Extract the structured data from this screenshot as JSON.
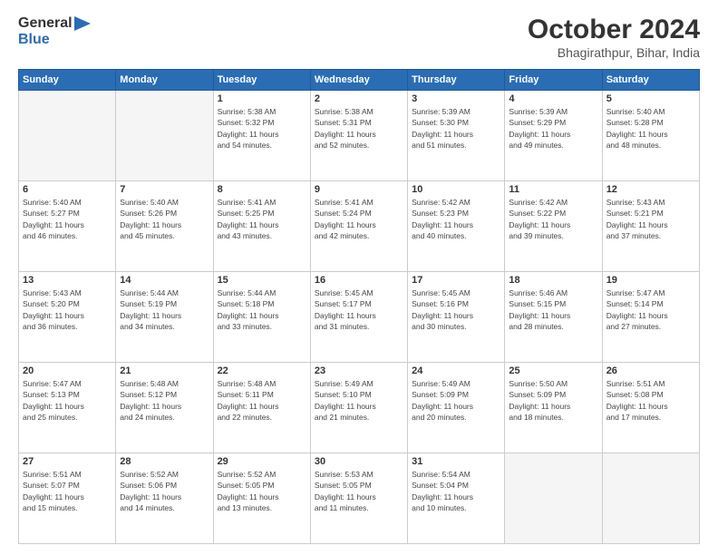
{
  "header": {
    "logo_line1": "General",
    "logo_line2": "Blue",
    "month_title": "October 2024",
    "location": "Bhagirathpur, Bihar, India"
  },
  "calendar": {
    "headers": [
      "Sunday",
      "Monday",
      "Tuesday",
      "Wednesday",
      "Thursday",
      "Friday",
      "Saturday"
    ],
    "weeks": [
      [
        {
          "day": "",
          "empty": true
        },
        {
          "day": "",
          "empty": true
        },
        {
          "day": "1",
          "sunrise": "5:38 AM",
          "sunset": "5:32 PM",
          "daylight": "11 hours and 54 minutes."
        },
        {
          "day": "2",
          "sunrise": "5:38 AM",
          "sunset": "5:31 PM",
          "daylight": "11 hours and 52 minutes."
        },
        {
          "day": "3",
          "sunrise": "5:39 AM",
          "sunset": "5:30 PM",
          "daylight": "11 hours and 51 minutes."
        },
        {
          "day": "4",
          "sunrise": "5:39 AM",
          "sunset": "5:29 PM",
          "daylight": "11 hours and 49 minutes."
        },
        {
          "day": "5",
          "sunrise": "5:40 AM",
          "sunset": "5:28 PM",
          "daylight": "11 hours and 48 minutes."
        }
      ],
      [
        {
          "day": "6",
          "sunrise": "5:40 AM",
          "sunset": "5:27 PM",
          "daylight": "11 hours and 46 minutes."
        },
        {
          "day": "7",
          "sunrise": "5:40 AM",
          "sunset": "5:26 PM",
          "daylight": "11 hours and 45 minutes."
        },
        {
          "day": "8",
          "sunrise": "5:41 AM",
          "sunset": "5:25 PM",
          "daylight": "11 hours and 43 minutes."
        },
        {
          "day": "9",
          "sunrise": "5:41 AM",
          "sunset": "5:24 PM",
          "daylight": "11 hours and 42 minutes."
        },
        {
          "day": "10",
          "sunrise": "5:42 AM",
          "sunset": "5:23 PM",
          "daylight": "11 hours and 40 minutes."
        },
        {
          "day": "11",
          "sunrise": "5:42 AM",
          "sunset": "5:22 PM",
          "daylight": "11 hours and 39 minutes."
        },
        {
          "day": "12",
          "sunrise": "5:43 AM",
          "sunset": "5:21 PM",
          "daylight": "11 hours and 37 minutes."
        }
      ],
      [
        {
          "day": "13",
          "sunrise": "5:43 AM",
          "sunset": "5:20 PM",
          "daylight": "11 hours and 36 minutes."
        },
        {
          "day": "14",
          "sunrise": "5:44 AM",
          "sunset": "5:19 PM",
          "daylight": "11 hours and 34 minutes."
        },
        {
          "day": "15",
          "sunrise": "5:44 AM",
          "sunset": "5:18 PM",
          "daylight": "11 hours and 33 minutes."
        },
        {
          "day": "16",
          "sunrise": "5:45 AM",
          "sunset": "5:17 PM",
          "daylight": "11 hours and 31 minutes."
        },
        {
          "day": "17",
          "sunrise": "5:45 AM",
          "sunset": "5:16 PM",
          "daylight": "11 hours and 30 minutes."
        },
        {
          "day": "18",
          "sunrise": "5:46 AM",
          "sunset": "5:15 PM",
          "daylight": "11 hours and 28 minutes."
        },
        {
          "day": "19",
          "sunrise": "5:47 AM",
          "sunset": "5:14 PM",
          "daylight": "11 hours and 27 minutes."
        }
      ],
      [
        {
          "day": "20",
          "sunrise": "5:47 AM",
          "sunset": "5:13 PM",
          "daylight": "11 hours and 25 minutes."
        },
        {
          "day": "21",
          "sunrise": "5:48 AM",
          "sunset": "5:12 PM",
          "daylight": "11 hours and 24 minutes."
        },
        {
          "day": "22",
          "sunrise": "5:48 AM",
          "sunset": "5:11 PM",
          "daylight": "11 hours and 22 minutes."
        },
        {
          "day": "23",
          "sunrise": "5:49 AM",
          "sunset": "5:10 PM",
          "daylight": "11 hours and 21 minutes."
        },
        {
          "day": "24",
          "sunrise": "5:49 AM",
          "sunset": "5:09 PM",
          "daylight": "11 hours and 20 minutes."
        },
        {
          "day": "25",
          "sunrise": "5:50 AM",
          "sunset": "5:09 PM",
          "daylight": "11 hours and 18 minutes."
        },
        {
          "day": "26",
          "sunrise": "5:51 AM",
          "sunset": "5:08 PM",
          "daylight": "11 hours and 17 minutes."
        }
      ],
      [
        {
          "day": "27",
          "sunrise": "5:51 AM",
          "sunset": "5:07 PM",
          "daylight": "11 hours and 15 minutes."
        },
        {
          "day": "28",
          "sunrise": "5:52 AM",
          "sunset": "5:06 PM",
          "daylight": "11 hours and 14 minutes."
        },
        {
          "day": "29",
          "sunrise": "5:52 AM",
          "sunset": "5:05 PM",
          "daylight": "11 hours and 13 minutes."
        },
        {
          "day": "30",
          "sunrise": "5:53 AM",
          "sunset": "5:05 PM",
          "daylight": "11 hours and 11 minutes."
        },
        {
          "day": "31",
          "sunrise": "5:54 AM",
          "sunset": "5:04 PM",
          "daylight": "11 hours and 10 minutes."
        },
        {
          "day": "",
          "empty": true
        },
        {
          "day": "",
          "empty": true
        }
      ]
    ]
  }
}
